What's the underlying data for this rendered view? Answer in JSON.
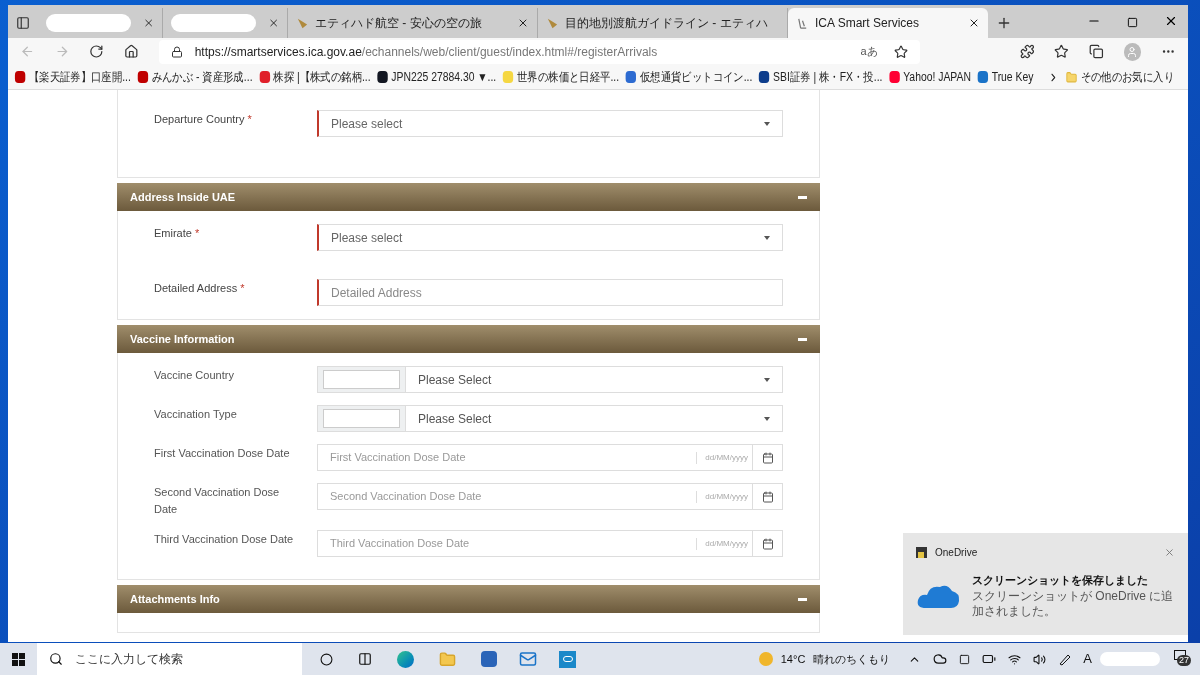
{
  "browser": {
    "tabs": [
      {
        "selected": false,
        "kind": "hidden"
      },
      {
        "selected": false,
        "kind": "hidden"
      },
      {
        "title": "エティハド航空 - 安心の空の旅",
        "selected": false,
        "kind": "bird"
      },
      {
        "title": "目的地別渡航ガイドライン - エティハ",
        "selected": false,
        "kind": "bird"
      },
      {
        "title": "ICA Smart Services",
        "selected": true,
        "kind": "ica"
      }
    ],
    "url_host": "https://smartservices.ica.gov.ae",
    "url_path": "/echannels/web/client/guest/index.html#/registerArrivals",
    "read_aloud": "aあ",
    "bookmarks": [
      {
        "label": "【楽天証券】口座開...",
        "color": "#bf0000"
      },
      {
        "label": "みんかぶ - 資産形成...",
        "color": "#c00000"
      },
      {
        "label": "株探 |【株式の銘柄...",
        "color": "#e0202a"
      },
      {
        "label": "JPN225 27884.30 ▼...",
        "color": "#131722"
      },
      {
        "label": "世界の株価と日経平...",
        "color": "#f5d742"
      },
      {
        "label": "仮想通貨ビットコイン...",
        "color": "#2d6bd1"
      },
      {
        "label": "SBI証券 | 株・FX・投...",
        "color": "#0d3d8c"
      },
      {
        "label": "Yahoo! JAPAN",
        "color": "#ff0033"
      },
      {
        "label": "True Key",
        "color": "#1a73c8"
      }
    ],
    "other_favorites": "その他のお気に入り"
  },
  "form": {
    "sections": [
      {
        "fields": [
          {
            "label": "Departure Country",
            "required": true,
            "asterisk": "*",
            "kind": "select",
            "value": "Please select"
          }
        ]
      },
      {
        "title": "Address Inside UAE",
        "expanded": true,
        "fields": [
          {
            "label": "Emirate",
            "required": true,
            "asterisk": "*",
            "kind": "select",
            "value": "Please select"
          },
          {
            "label": "Detailed Address",
            "required": true,
            "asterisk": "*",
            "kind": "text",
            "placeholder": "Detailed Address"
          }
        ]
      },
      {
        "title": "Vaccine Information",
        "expanded": true,
        "fields": [
          {
            "label": "Vaccine Country",
            "required": false,
            "kind": "combo",
            "value": "Please Select"
          },
          {
            "label": "Vaccination Type",
            "required": false,
            "kind": "combo",
            "value": "Please Select"
          },
          {
            "label": "First Vaccination Dose Date",
            "required": false,
            "kind": "date",
            "placeholder": "First Vaccination Dose Date",
            "format": "dd/MM/yyyy"
          },
          {
            "label": "Second Vaccination Dose Date",
            "required": false,
            "kind": "date",
            "placeholder": "Second Vaccination Dose Date",
            "format": "dd/MM/yyyy"
          },
          {
            "label": "Third Vaccination Dose Date",
            "required": false,
            "kind": "date",
            "placeholder": "Third Vaccination Dose Date",
            "format": "dd/MM/yyyy"
          }
        ]
      },
      {
        "title": "Attachments Info",
        "expanded": true
      }
    ]
  },
  "notification": {
    "app": "OneDrive",
    "title": "スクリーンショットを保存しました",
    "body": "スクリーンショットが OneDrive に追加されました。"
  },
  "taskbar": {
    "search_placeholder": "ここに入力して検索",
    "temperature": "14°C",
    "weather": "晴れのちくもり",
    "ime": "A",
    "notification_count": "27"
  }
}
